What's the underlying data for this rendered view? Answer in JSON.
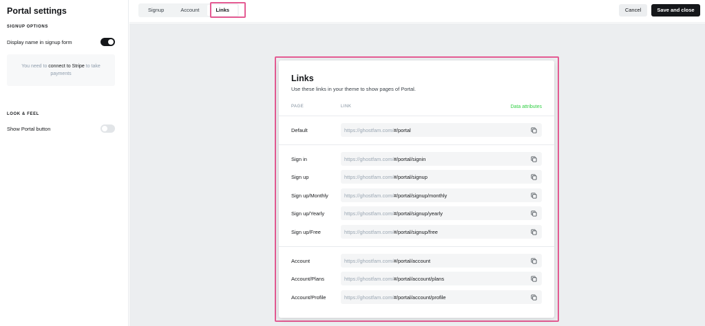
{
  "sidebar": {
    "title": "Portal settings",
    "signup_heading": "SIGNUP OPTIONS",
    "display_name_label": "Display name in signup form",
    "display_name_on": true,
    "stripe_text_before": "You need to ",
    "stripe_link": "connect to Stripe",
    "stripe_text_after": " to take payments",
    "look_heading": "LOOK & FEEL",
    "show_portal_label": "Show Portal button",
    "show_portal_on": false
  },
  "topbar": {
    "tabs": [
      {
        "label": "Signup",
        "active": false
      },
      {
        "label": "Account",
        "active": false
      },
      {
        "label": "Links",
        "active": true
      }
    ],
    "cancel_label": "Cancel",
    "save_label": "Save and close"
  },
  "panel": {
    "title": "Links",
    "description": "Use these links in your theme to show pages of Portal.",
    "col_page": "PAGE",
    "col_link": "LINK",
    "data_attributes": "Data attributes",
    "base_url": "https://ghostfam.com/",
    "rows": [
      {
        "label": "Default",
        "path": "#/portal"
      },
      {
        "label": "Sign in",
        "path": "#/portal/signin"
      },
      {
        "label": "Sign up",
        "path": "#/portal/signup"
      },
      {
        "label": "Sign up/Monthly",
        "path": "#/portal/signup/monthly"
      },
      {
        "label": "Sign up/Yearly",
        "path": "#/portal/signup/yearly"
      },
      {
        "label": "Sign up/Free",
        "path": "#/portal/signup/free"
      },
      {
        "label": "Account",
        "path": "#/portal/account"
      },
      {
        "label": "Account/Plans",
        "path": "#/portal/account/plans"
      },
      {
        "label": "Account/Profile",
        "path": "#/portal/account/profile"
      }
    ]
  }
}
